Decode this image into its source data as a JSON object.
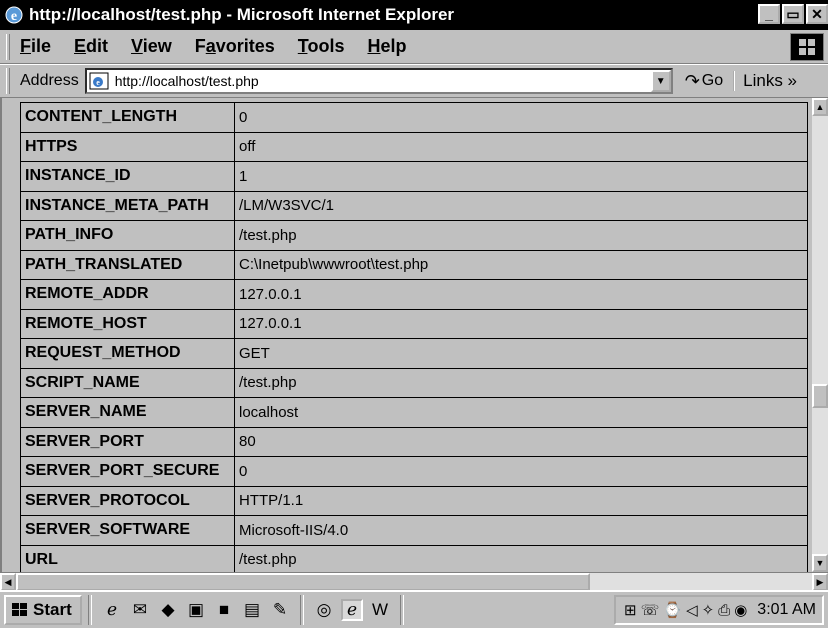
{
  "window": {
    "title": "http://localhost/test.php - Microsoft Internet Explorer",
    "minimize": "_",
    "restore": "▭",
    "close": "✕"
  },
  "menu": {
    "items": [
      "File",
      "Edit",
      "View",
      "Favorites",
      "Tools",
      "Help"
    ],
    "underline": [
      "F",
      "E",
      "V",
      "a",
      "T",
      "H"
    ]
  },
  "address": {
    "label": "Address",
    "url": "http://localhost/test.php",
    "go_label": "Go",
    "links_label": "Links »"
  },
  "server_vars": [
    {
      "key": "CONTENT_LENGTH",
      "value": "0"
    },
    {
      "key": "HTTPS",
      "value": "off"
    },
    {
      "key": "INSTANCE_ID",
      "value": "1"
    },
    {
      "key": "INSTANCE_META_PATH",
      "value": "/LM/W3SVC/1"
    },
    {
      "key": "PATH_INFO",
      "value": "/test.php"
    },
    {
      "key": "PATH_TRANSLATED",
      "value": "C:\\Inetpub\\wwwroot\\test.php"
    },
    {
      "key": "REMOTE_ADDR",
      "value": "127.0.0.1"
    },
    {
      "key": "REMOTE_HOST",
      "value": "127.0.0.1"
    },
    {
      "key": "REQUEST_METHOD",
      "value": "GET"
    },
    {
      "key": "SCRIPT_NAME",
      "value": "/test.php"
    },
    {
      "key": "SERVER_NAME",
      "value": "localhost"
    },
    {
      "key": "SERVER_PORT",
      "value": "80"
    },
    {
      "key": "SERVER_PORT_SECURE",
      "value": "0"
    },
    {
      "key": "SERVER_PROTOCOL",
      "value": "HTTP/1.1"
    },
    {
      "key": "SERVER_SOFTWARE",
      "value": "Microsoft-IIS/4.0"
    },
    {
      "key": "URL",
      "value": "/test.php"
    }
  ],
  "taskbar": {
    "start_label": "Start",
    "clock": "3:01 AM",
    "quick_launch_icons": [
      "ie-icon",
      "outlook-icon",
      "channels-icon",
      "desktop-icon",
      "terminal-icon",
      "explorer-icon",
      "notepad-icon"
    ],
    "task_icons": [
      "paint-icon",
      "ie-window-icon",
      "word-icon"
    ],
    "tray_icons": [
      "network-icon",
      "modem-icon",
      "scheduler-icon",
      "volume-icon",
      "antivirus-icon",
      "printer-icon",
      "power-icon"
    ]
  }
}
